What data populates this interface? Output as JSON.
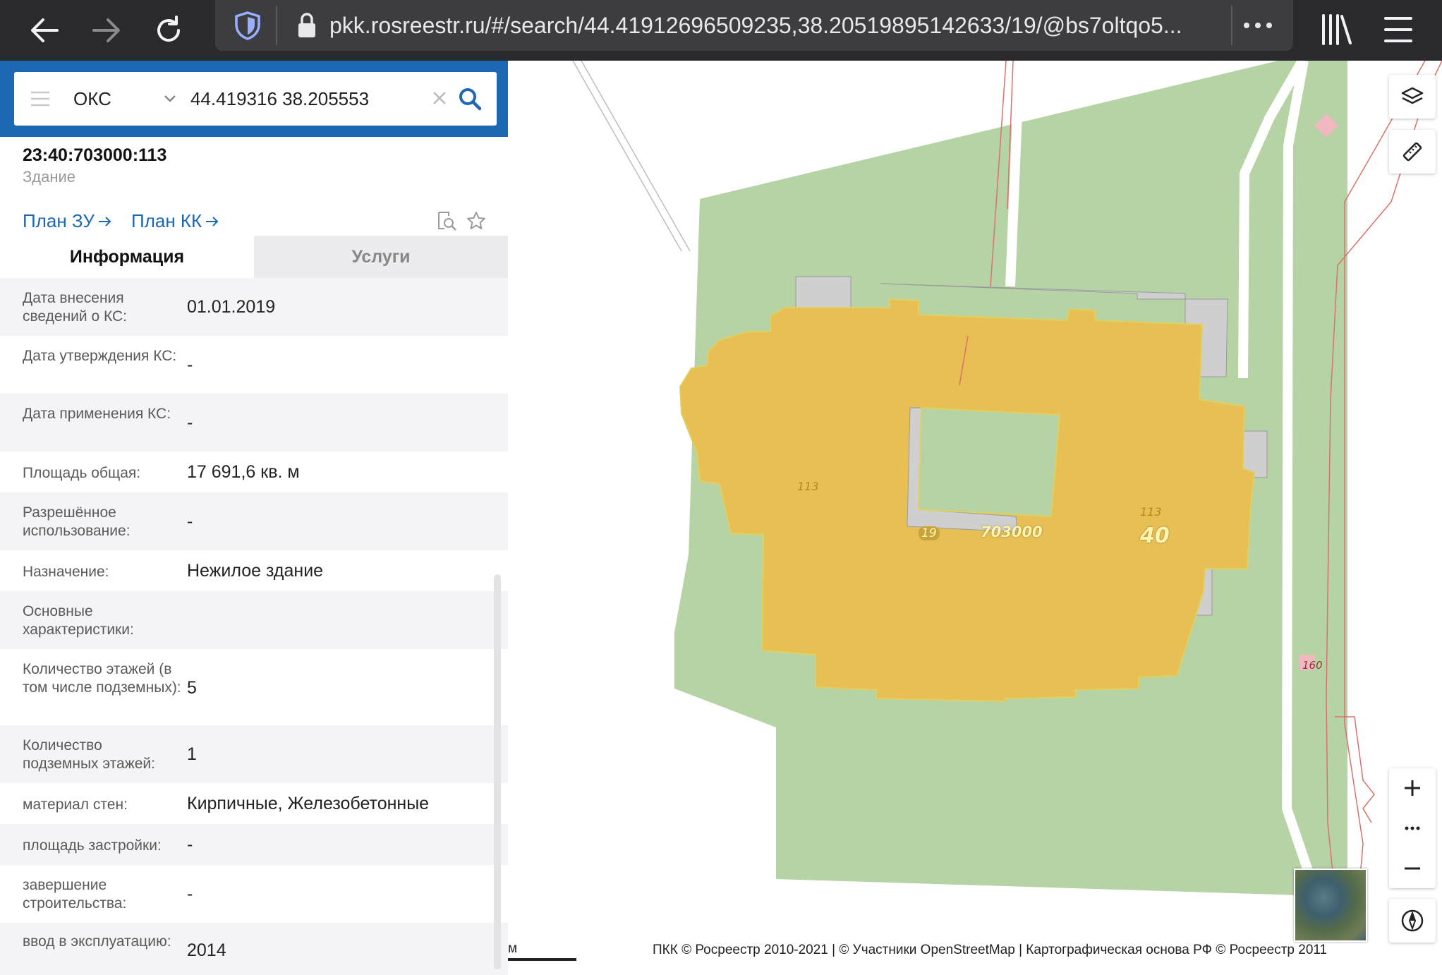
{
  "browser": {
    "url": "pkk.rosreestr.ru/#/search/44.41912696509235,38.20519895142633/19/@bs7oltqo5..."
  },
  "search": {
    "type_label": "ОКС",
    "query": "44.419316 38.205553"
  },
  "object": {
    "cadastral_number": "23:40:703000:113",
    "type": "Здание",
    "links": [
      {
        "label": "План ЗУ"
      },
      {
        "label": "План КК"
      }
    ]
  },
  "tabs": [
    {
      "label": "Информация",
      "active": true
    },
    {
      "label": "Услуги",
      "active": false
    }
  ],
  "info_rows": [
    {
      "label": "Дата внесения сведений о КС:",
      "value": "01.01.2019"
    },
    {
      "label": "Дата утверждения КС:",
      "value": "-"
    },
    {
      "label": "Дата применения КС:",
      "value": "-"
    },
    {
      "label": "Площадь общая:",
      "value": "17 691,6 кв. м"
    },
    {
      "label": "Разрешённое использование:",
      "value": "-"
    },
    {
      "label": "Назначение:",
      "value": "Нежилое здание"
    },
    {
      "label": "Основные характеристики:",
      "value": ""
    },
    {
      "label": "Количество этажей (в том числе подземных):",
      "value": "5"
    },
    {
      "label": "Количество подземных этажей:",
      "value": "1"
    },
    {
      "label": "материал стен:",
      "value": "Кирпичные, Железобетонные"
    },
    {
      "label": "площадь застройки:",
      "value": "-"
    },
    {
      "label": "завершение строительства:",
      "value": "-"
    },
    {
      "label": "ввод в эксплуатацию:",
      "value": "2014"
    }
  ],
  "map": {
    "labels": {
      "parcel_left": "113",
      "parcel_right": "113",
      "quarter_num": "19",
      "quarter": "703000",
      "block": "40",
      "plot_160": "160"
    },
    "scale_text": "м",
    "attribution": "ПКК © Росреестр 2010-2021 | © Участники OpenStreetMap | Картографическая основа РФ © Росреестр 2011",
    "colors": {
      "building_fill": "#e7bf55",
      "land_fill": "#b6d3a5",
      "structure_gray": "#cfcfcf",
      "boundary_red": "#d9726a",
      "accent_blue": "#1c68b3"
    }
  },
  "icons": [
    "back-arrow-icon",
    "forward-arrow-icon",
    "reload-icon",
    "tracking-shield-icon",
    "lock-icon",
    "more-dots-icon",
    "library-icon",
    "menu-icon",
    "hamburger-icon",
    "chevron-down-icon",
    "clear-icon",
    "search-icon",
    "collapse-chevron-icon",
    "arrow-right-icon",
    "search-document-icon",
    "star-icon",
    "layers-icon",
    "ruler-icon",
    "zoom-in-icon",
    "zoom-more-icon",
    "zoom-out-icon",
    "compass-icon"
  ]
}
